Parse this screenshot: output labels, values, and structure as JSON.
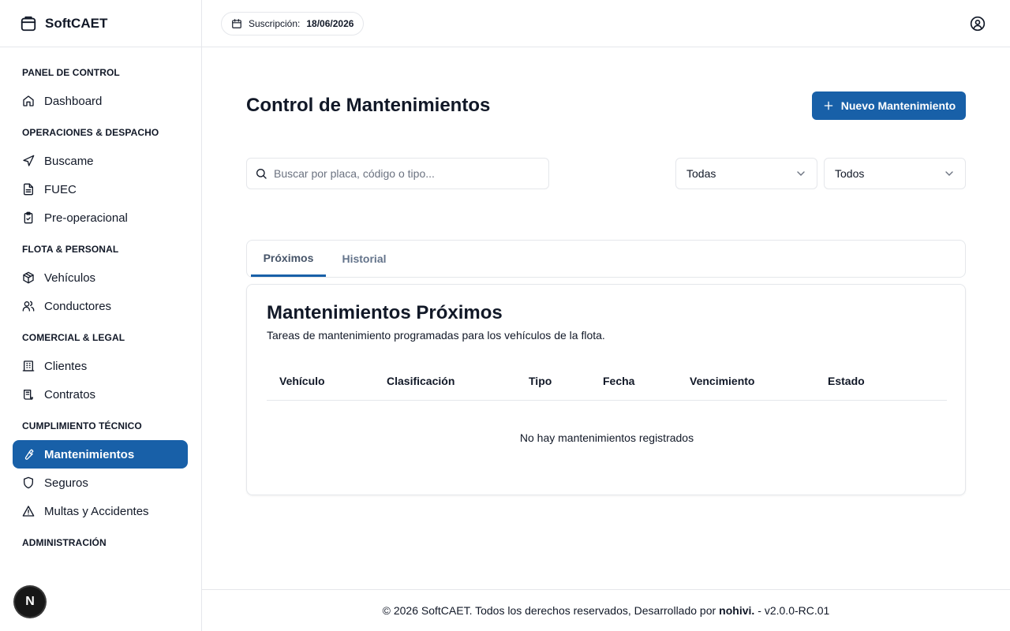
{
  "brand": {
    "name": "SoftCAET",
    "icon": "box-icon"
  },
  "sidebar": {
    "sections": [
      {
        "title": "PANEL DE CONTROL",
        "items": [
          {
            "label": "Dashboard",
            "icon": "home-icon"
          }
        ]
      },
      {
        "title": "OPERACIONES & DESPACHO",
        "items": [
          {
            "label": "Buscame",
            "icon": "navigation-icon"
          },
          {
            "label": "FUEC",
            "icon": "document-icon"
          },
          {
            "label": "Pre-operacional",
            "icon": "clipboard-check-icon"
          }
        ]
      },
      {
        "title": "FLOTA & PERSONAL",
        "items": [
          {
            "label": "Vehículos",
            "icon": "package-icon"
          },
          {
            "label": "Conductores",
            "icon": "users-icon"
          }
        ]
      },
      {
        "title": "COMERCIAL & LEGAL",
        "items": [
          {
            "label": "Clientes",
            "icon": "building-icon"
          },
          {
            "label": "Contratos",
            "icon": "scroll-icon"
          }
        ]
      },
      {
        "title": "CUMPLIMIENTO TÉCNICO",
        "items": [
          {
            "label": "Mantenimientos",
            "icon": "wrench-icon",
            "active": true
          },
          {
            "label": "Seguros",
            "icon": "shield-icon"
          },
          {
            "label": "Multas y Accidentes",
            "icon": "alert-triangle-icon"
          }
        ]
      },
      {
        "title": "ADMINISTRACIÓN",
        "items": []
      }
    ],
    "badge": "N"
  },
  "topbar": {
    "subscription_label": "Suscripción:",
    "subscription_date": "18/06/2026"
  },
  "main": {
    "title": "Control de Mantenimientos",
    "new_button": "Nuevo Mantenimiento",
    "search_placeholder": "Buscar por placa, código o tipo...",
    "filter1": "Todas",
    "filter2": "Todos",
    "tabs": [
      "Próximos",
      "Historial"
    ],
    "card": {
      "title": "Mantenimientos Próximos",
      "description": "Tareas de mantenimiento programadas para los vehículos de la flota.",
      "columns": [
        "Vehículo",
        "Clasificación",
        "Tipo",
        "Fecha",
        "Vencimiento",
        "Estado"
      ],
      "empty": "No hay mantenimientos registrados"
    }
  },
  "footer": {
    "text": "© 2026 SoftCAET. Todos los derechos reservados, Desarrollado por",
    "dev": "nohivi.",
    "version": "- v2.0.0-RC.01"
  },
  "colors": {
    "primary": "#1860a8",
    "border": "#e5e7eb",
    "text": "#111827",
    "muted": "#64748b"
  }
}
